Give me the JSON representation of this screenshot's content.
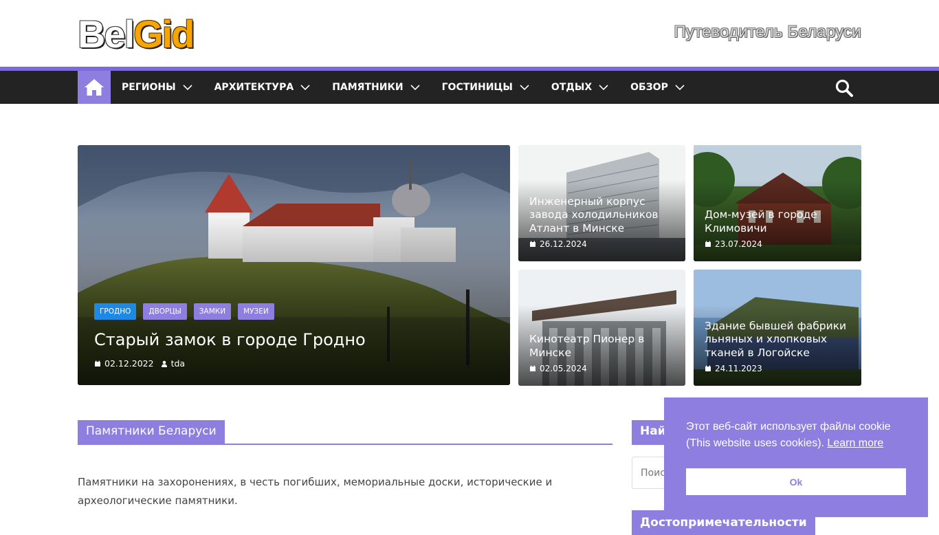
{
  "header": {
    "logo_part1": "Bel",
    "logo_part2": "Gid",
    "tagline": "Путеводитель Беларуси"
  },
  "nav": {
    "home_icon": "home-icon",
    "items": [
      {
        "label": "РЕГИОНЫ"
      },
      {
        "label": "АРХИТЕКТУРА"
      },
      {
        "label": "ПАМЯТНИКИ"
      },
      {
        "label": "ГОСТИНИЦЫ"
      },
      {
        "label": "ОТДЫХ"
      },
      {
        "label": "ОБЗОР"
      }
    ],
    "search_icon": "search-icon"
  },
  "featured": {
    "tags": [
      {
        "label": "ГРОДНО",
        "color": "#1e88e5"
      },
      {
        "label": "ДВОРЦЫ",
        "color": "#8e7ee0"
      },
      {
        "label": "ЗАМКИ",
        "color": "#8e7ee0"
      },
      {
        "label": "МУЗЕИ",
        "color": "#8e7ee0"
      }
    ],
    "title": "Старый замок в городе Гродно",
    "date": "02.12.2022",
    "author": "tda"
  },
  "cards": [
    {
      "title": "Инженерный корпус завода холодильников Атлант в Минске",
      "date": "26.12.2024"
    },
    {
      "title": "Дом-музей в городе Климовичи",
      "date": "23.07.2024"
    },
    {
      "title": "Кинотеатр Пионер в Минске",
      "date": "02.05.2024"
    },
    {
      "title": "Здание бывшей фабрики льняных и хлопковых тканей в Логойске",
      "date": "24.11.2023"
    }
  ],
  "section": {
    "heading": "Памятники Беларуси",
    "text": "Памятники на захоронениях, в честь погибших, мемориальные доски, исторические и археологические памятники."
  },
  "sidebar": {
    "search_heading": "Найти",
    "search_placeholder": "Поиск",
    "heading2": "Достопримечательности"
  },
  "cookie": {
    "message": "Этот веб-сайт использует файлы cookie (This website uses cookies).",
    "learn_more": "Learn more",
    "ok_label": "Ok"
  },
  "colors": {
    "accent": "#8e7ee0",
    "nav_bg": "#232323",
    "tag_blue": "#1e88e5"
  }
}
